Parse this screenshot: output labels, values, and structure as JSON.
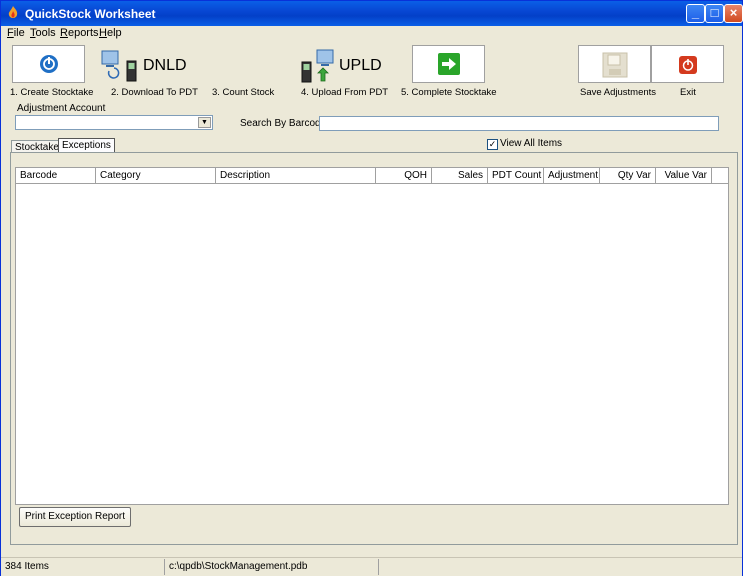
{
  "window": {
    "title": "QuickStock Worksheet"
  },
  "menu": [
    {
      "label": "File",
      "key": "F",
      "rest": "ile"
    },
    {
      "label": "Tools",
      "key": "T",
      "rest": "ools"
    },
    {
      "label": "Reports",
      "key": "R",
      "rest": "eports"
    },
    {
      "label": "Help",
      "key": "H",
      "rest": "elp"
    }
  ],
  "toolbar": {
    "create_label": "1. Create Stocktake",
    "download_label": "2. Download To PDT",
    "download_text": "DNLD",
    "count_label": "3. Count Stock",
    "upload_label": "4. Upload From PDT",
    "upload_text": "UPLD",
    "complete_label": "5. Complete Stocktake",
    "save_label": "Save Adjustments",
    "exit_label": "Exit"
  },
  "filters": {
    "adjustment_account_label": "Adjustment Account",
    "adjustment_account_value": "",
    "search_label": "Search By Barcode",
    "search_value": "",
    "view_all_label": "View All Items",
    "view_all_checked": true
  },
  "tabs": [
    {
      "label": "Stocktake",
      "active": false
    },
    {
      "label": "Exceptions",
      "active": true
    }
  ],
  "grid": {
    "columns": [
      "Barcode",
      "Category",
      "Description",
      "QOH",
      "Sales",
      "PDT Count",
      "Adjustment",
      "Qty Var",
      "Value Var"
    ],
    "rows": []
  },
  "actions": {
    "print_label": "Print Exception Report"
  },
  "status": {
    "items": "384 Items",
    "path": "c:\\qpdb\\StockManagement.pdb"
  },
  "colors": {
    "title_bar": "#0a5fe7",
    "window_bg": "#ece9d8",
    "complete_arrow": "#2aa52a",
    "exit_icon": "#d43a1e",
    "create_icon": "#1f6fc5"
  }
}
